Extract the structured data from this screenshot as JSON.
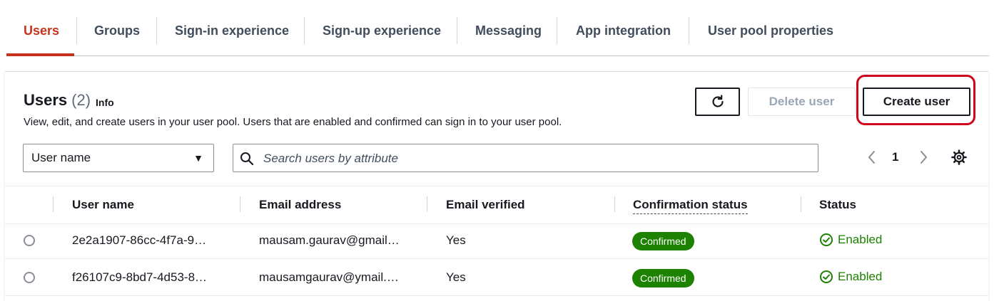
{
  "tabs": [
    {
      "label": "Users",
      "active": true
    },
    {
      "label": "Groups"
    },
    {
      "label": "Sign-in experience"
    },
    {
      "label": "Sign-up experience"
    },
    {
      "label": "Messaging"
    },
    {
      "label": "App integration"
    },
    {
      "label": "User pool properties"
    }
  ],
  "panel": {
    "title": "Users",
    "count": "(2)",
    "info_label": "Info",
    "description": "View, edit, and create users in your user pool. Users that are enabled and confirmed can sign in to your user pool.",
    "refresh_icon": "refresh-icon",
    "delete_label": "Delete user",
    "create_label": "Create user"
  },
  "filter": {
    "property_value": "User name",
    "search_placeholder": "Search users by attribute"
  },
  "pagination": {
    "current_page": "1"
  },
  "table": {
    "headers": [
      "User name",
      "Email address",
      "Email verified",
      "Confirmation status",
      "Status"
    ],
    "rows": [
      {
        "user_name": "2e2a1907-86cc-4f7a-9…",
        "email": "mausam.gaurav@gmail…",
        "verified": "Yes",
        "confirmation": "Confirmed",
        "status": "Enabled"
      },
      {
        "user_name": "f26107c9-8bd7-4d53-8…",
        "email": "mausamgaurav@ymail.…",
        "verified": "Yes",
        "confirmation": "Confirmed",
        "status": "Enabled"
      }
    ]
  },
  "colors": {
    "active_tab": "#c6321c",
    "success": "#1d8102",
    "highlight": "#d0021b"
  }
}
